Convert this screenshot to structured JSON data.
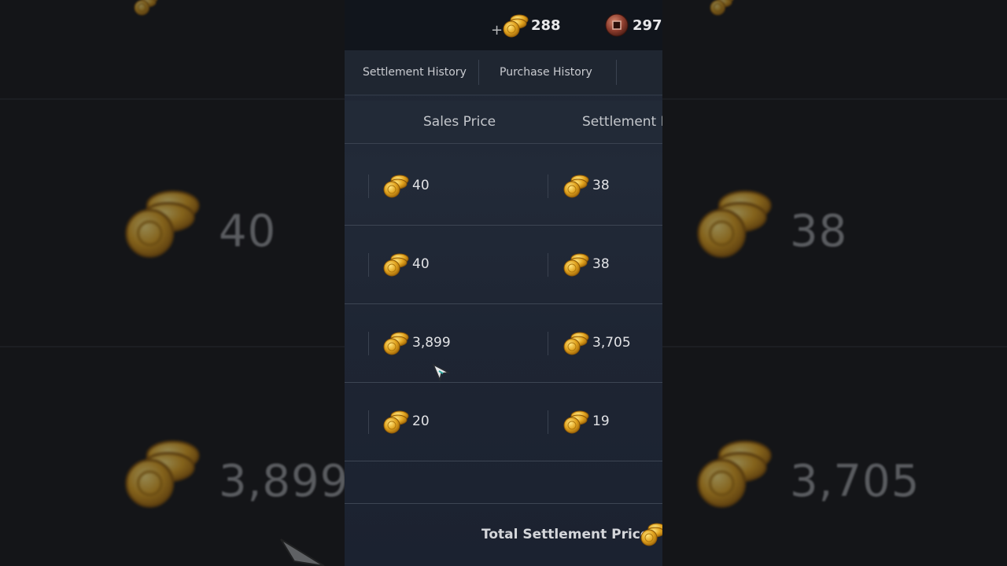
{
  "currency": {
    "gold_amount": "288",
    "bronze_amount": "297.",
    "add_symbol": "+"
  },
  "tabs": [
    {
      "label": "Settlement History"
    },
    {
      "label": "Purchase History"
    }
  ],
  "columns": {
    "sales_price": "Sales Price",
    "settlement_price": "Settlement I"
  },
  "rows": [
    {
      "sales": "40",
      "settlement": "38"
    },
    {
      "sales": "40",
      "settlement": "38"
    },
    {
      "sales": "3,899",
      "settlement": "3,705"
    },
    {
      "sales": "20",
      "settlement": "19"
    }
  ],
  "footer": {
    "total_label": "Total Settlement Price"
  },
  "backdrop": {
    "left_values": [
      "40",
      "3,899"
    ],
    "right_values": [
      "38",
      "3,705"
    ]
  },
  "colors": {
    "gold": "#e0a21e",
    "bronze": "#8a3b2c",
    "panel": "#1f2631"
  }
}
